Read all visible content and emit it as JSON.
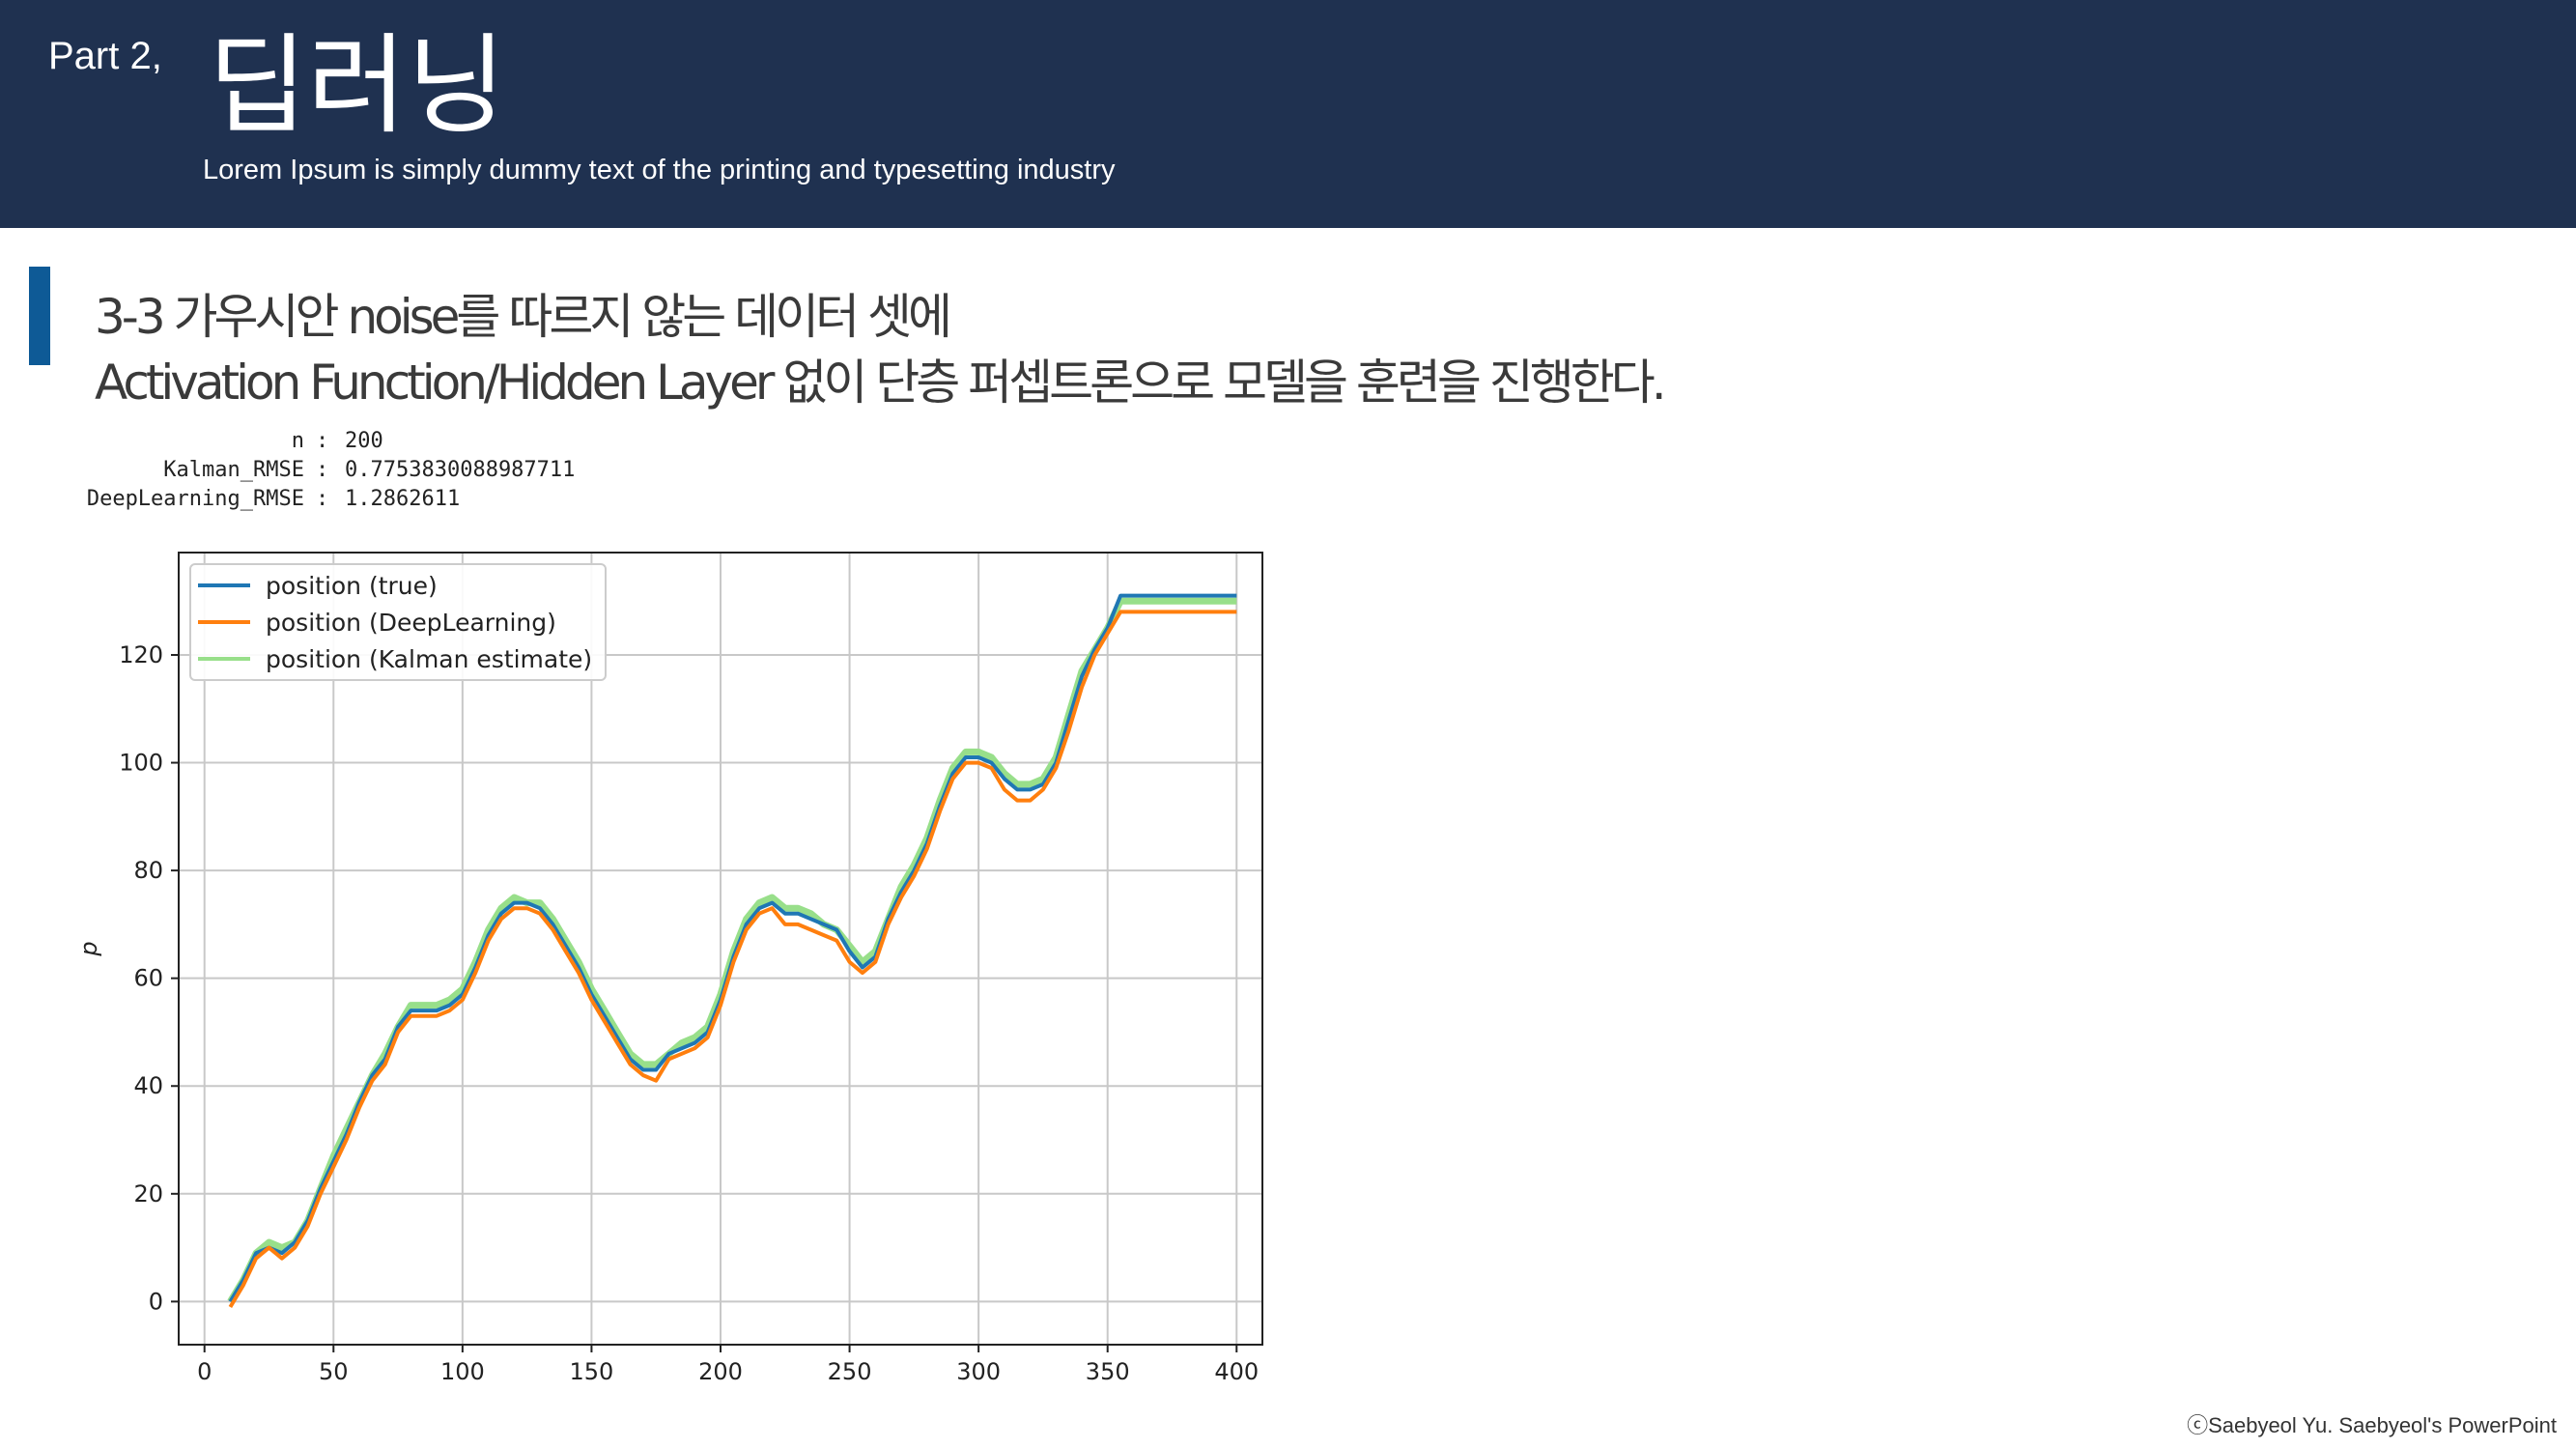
{
  "header": {
    "part_label": "Part 2,",
    "title": "딥러닝",
    "subtitle": "Lorem Ipsum is simply dummy text of the printing and typesetting industry"
  },
  "heading": {
    "line1": "3-3 가우시안 noise를 따르지 않는 데이터 셋에",
    "line2": "Activation Function/Hidden Layer 없이 단층 퍼셉트론으로 모델을 훈련을 진행한다."
  },
  "stats": [
    {
      "key": "n",
      "value": "200"
    },
    {
      "key": "Kalman_RMSE",
      "value": "0.7753830088987711"
    },
    {
      "key": "DeepLearning_RMSE",
      "value": "1.2862611"
    }
  ],
  "chart_data": {
    "type": "line",
    "ylabel": "p",
    "xlabel": "",
    "xlim": [
      -10,
      410
    ],
    "ylim": [
      -8,
      139
    ],
    "xticks": [
      0,
      50,
      100,
      150,
      200,
      250,
      300,
      350,
      400
    ],
    "yticks": [
      0,
      20,
      40,
      60,
      80,
      100,
      120
    ],
    "grid": true,
    "legend_position": "top-left",
    "x": [
      10,
      15,
      20,
      25,
      30,
      35,
      40,
      45,
      50,
      55,
      60,
      65,
      70,
      75,
      80,
      85,
      90,
      95,
      100,
      105,
      110,
      115,
      120,
      125,
      130,
      135,
      140,
      145,
      150,
      155,
      160,
      165,
      170,
      175,
      180,
      185,
      190,
      195,
      200,
      205,
      210,
      215,
      220,
      225,
      230,
      235,
      240,
      245,
      250,
      255,
      260,
      265,
      270,
      275,
      280,
      285,
      290,
      295,
      300,
      305,
      310,
      315,
      320,
      325,
      330,
      335,
      340,
      345,
      350,
      355,
      360,
      365,
      370,
      375,
      380,
      385,
      390,
      395,
      400
    ],
    "series": [
      {
        "name": "position (true)",
        "color": "#1f77b4",
        "values": [
          0,
          4,
          9,
          10,
          9,
          11,
          15,
          21,
          26,
          31,
          37,
          42,
          45,
          51,
          54,
          54,
          54,
          55,
          57,
          62,
          68,
          72,
          74,
          74,
          73,
          70,
          66,
          62,
          57,
          53,
          49,
          45,
          43,
          43,
          46,
          47,
          48,
          50,
          56,
          64,
          70,
          73,
          74,
          72,
          72,
          71,
          70,
          69,
          65,
          62,
          64,
          71,
          76,
          80,
          85,
          92,
          98,
          101,
          101,
          100,
          97,
          95,
          95,
          96,
          100,
          108,
          116,
          121,
          125,
          131,
          131,
          131,
          131,
          131,
          131,
          131,
          131,
          131,
          131
        ]
      },
      {
        "name": "position (DeepLearning)",
        "color": "#ff7f0e",
        "values": [
          -1,
          3,
          8,
          10,
          8,
          10,
          14,
          20,
          25,
          30,
          36,
          41,
          44,
          50,
          53,
          53,
          53,
          54,
          56,
          61,
          67,
          71,
          73,
          73,
          72,
          69,
          65,
          61,
          56,
          52,
          48,
          44,
          42,
          41,
          45,
          46,
          47,
          49,
          55,
          63,
          69,
          72,
          73,
          70,
          70,
          69,
          68,
          67,
          63,
          61,
          63,
          70,
          75,
          79,
          84,
          91,
          97,
          100,
          100,
          99,
          95,
          93,
          93,
          95,
          99,
          106,
          114,
          120,
          124,
          128,
          128,
          128,
          128,
          128,
          128,
          128,
          128,
          128,
          128
        ]
      },
      {
        "name": "position (Kalman estimate)",
        "color": "#98df8a",
        "values": [
          0,
          4,
          9,
          11,
          10,
          11,
          15,
          21,
          27,
          32,
          37,
          42,
          46,
          51,
          55,
          55,
          55,
          56,
          58,
          63,
          69,
          73,
          75,
          74,
          74,
          71,
          67,
          63,
          58,
          54,
          50,
          46,
          44,
          44,
          46,
          48,
          49,
          51,
          57,
          65,
          71,
          74,
          75,
          73,
          73,
          72,
          70,
          69,
          66,
          63,
          65,
          71,
          77,
          81,
          86,
          93,
          99,
          102,
          102,
          101,
          98,
          96,
          96,
          97,
          101,
          109,
          117,
          121,
          125,
          130,
          130,
          130,
          130,
          130,
          130,
          130,
          130,
          130,
          130
        ]
      }
    ]
  },
  "footer": {
    "copyright": "ⓒSaebyeol Yu. Saebyeol's PowerPoint"
  }
}
